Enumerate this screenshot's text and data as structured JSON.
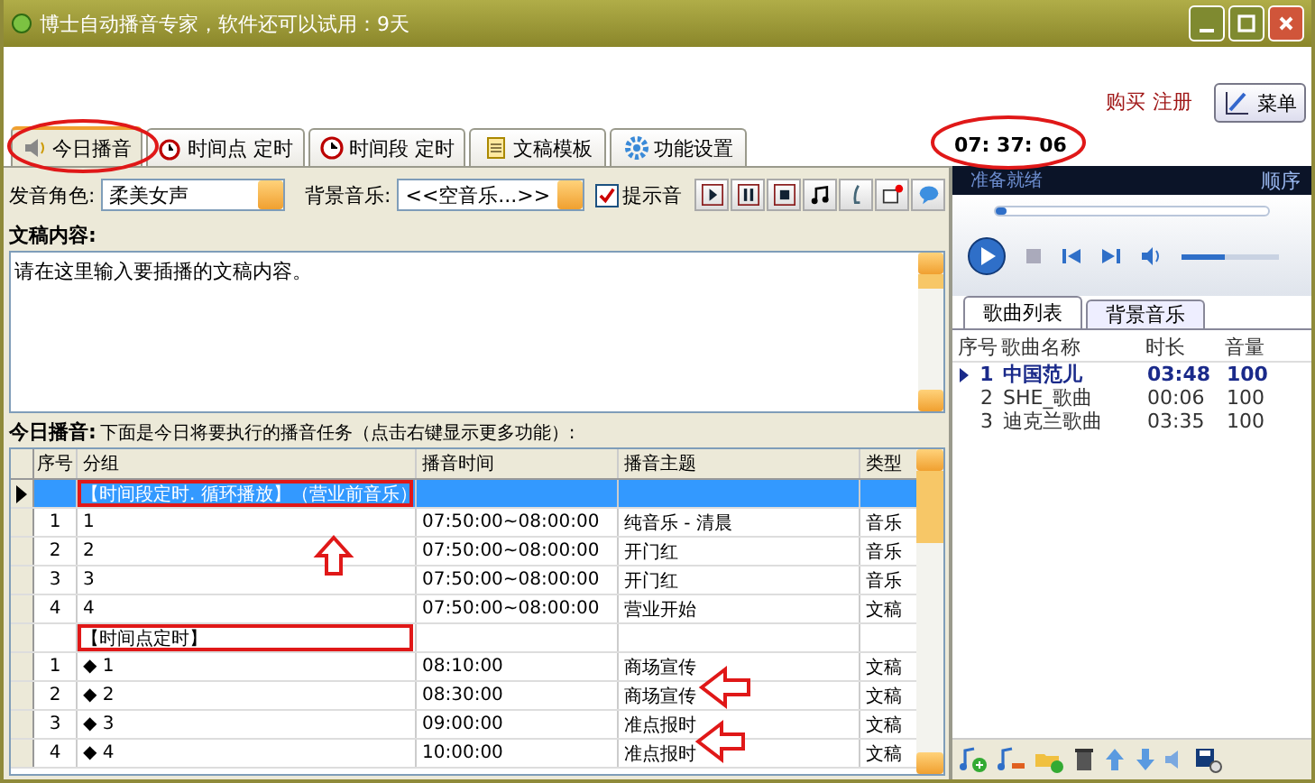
{
  "window": {
    "title": "博士自动播音专家，软件还可以试用：9天"
  },
  "header_links": [
    "购买",
    "注册"
  ],
  "menu_button": {
    "label": "菜单"
  },
  "tabs": [
    {
      "label": "今日播音",
      "selected": true
    },
    {
      "label": "时间点 定时",
      "selected": false
    },
    {
      "label": "时间段 定时",
      "selected": false
    },
    {
      "label": "文稿模板",
      "selected": false
    },
    {
      "label": "功能设置",
      "selected": false
    }
  ],
  "clock": "07: 37: 06",
  "voice": {
    "label": "发音角色:",
    "value": "柔美女声"
  },
  "bg_music": {
    "label": "背景音乐:",
    "value": "<<空音乐...>>"
  },
  "prompt_tone": {
    "label": "提示音",
    "checked": true
  },
  "content": {
    "label": "文稿内容:",
    "value": "请在这里输入要插播的文稿内容。"
  },
  "today": {
    "label": "今日播音:",
    "hint": "下面是今日将要执行的播音任务（点击右键显示更多功能）:"
  },
  "table": {
    "columns": [
      "序号",
      "分组",
      "播音时间",
      "播音主题",
      "类型"
    ],
    "rows": [
      {
        "kind": "group",
        "label": "【时间段定时. 循环播放】（营业前音乐）",
        "selected": true
      },
      {
        "kind": "item",
        "cells": [
          "1",
          "1",
          "07:50:00~08:00:00",
          "纯音乐 - 清晨",
          "音乐"
        ],
        "selected": false
      },
      {
        "kind": "item",
        "cells": [
          "2",
          "2",
          "07:50:00~08:00:00",
          "开门红",
          "音乐"
        ],
        "selected": false
      },
      {
        "kind": "item",
        "cells": [
          "3",
          "3",
          "07:50:00~08:00:00",
          "开门红",
          "音乐"
        ],
        "selected": false
      },
      {
        "kind": "item",
        "cells": [
          "4",
          "4",
          "07:50:00~08:00:00",
          "营业开始",
          "文稿"
        ],
        "selected": false
      },
      {
        "kind": "group",
        "label": "【时间点定时】",
        "selected": false
      },
      {
        "kind": "item",
        "cells": [
          "1",
          "◆ 1",
          "08:10:00",
          "商场宣传",
          "文稿"
        ],
        "selected": false
      },
      {
        "kind": "item",
        "cells": [
          "2",
          "◆ 2",
          "08:30:00",
          "商场宣传",
          "文稿"
        ],
        "selected": false
      },
      {
        "kind": "item",
        "cells": [
          "3",
          "◆ 3",
          "09:00:00",
          "准点报时",
          "文稿"
        ],
        "selected": false
      },
      {
        "kind": "item",
        "cells": [
          "4",
          "◆ 4",
          "10:00:00",
          "准点报时",
          "文稿"
        ],
        "selected": false
      }
    ]
  },
  "player": {
    "status": "准备就绪",
    "mode": "顺序",
    "seek": {
      "level": 0.04
    },
    "volume": {
      "level": 0.45
    },
    "tabs": [
      {
        "label": "歌曲列表",
        "selected": true
      },
      {
        "label": "背景音乐",
        "selected": false
      }
    ],
    "columns": [
      "序号",
      "歌曲名称",
      "时长",
      "音量"
    ],
    "songs": [
      {
        "cells": [
          "1",
          "中国范儿",
          "03:48",
          "100"
        ],
        "playing": true
      },
      {
        "cells": [
          "2",
          "SHE_歌曲",
          "00:06",
          "100"
        ],
        "playing": false
      },
      {
        "cells": [
          "3",
          "迪克兰歌曲",
          "03:35",
          "100"
        ],
        "playing": false
      }
    ]
  }
}
